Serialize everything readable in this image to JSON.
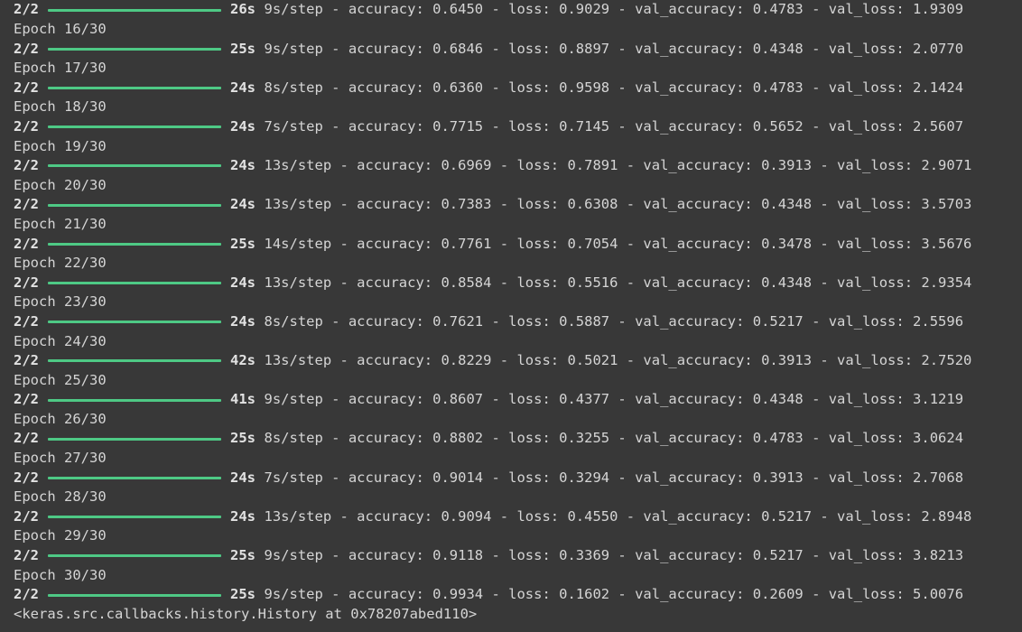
{
  "steps_prefix": "2/2",
  "bar_color": "#4ec985",
  "progress_fraction": 1.0,
  "lines": [
    {
      "kind": "progress",
      "time": "26s",
      "metrics": "9s/step - accuracy: 0.6450 - loss: 0.9029 - val_accuracy: 0.4783 - val_loss: 1.9309"
    },
    {
      "kind": "epoch",
      "text": "Epoch 16/30"
    },
    {
      "kind": "progress",
      "time": "25s",
      "metrics": "9s/step - accuracy: 0.6846 - loss: 0.8897 - val_accuracy: 0.4348 - val_loss: 2.0770"
    },
    {
      "kind": "epoch",
      "text": "Epoch 17/30"
    },
    {
      "kind": "progress",
      "time": "24s",
      "metrics": "8s/step - accuracy: 0.6360 - loss: 0.9598 - val_accuracy: 0.4783 - val_loss: 2.1424"
    },
    {
      "kind": "epoch",
      "text": "Epoch 18/30"
    },
    {
      "kind": "progress",
      "time": "24s",
      "metrics": "7s/step - accuracy: 0.7715 - loss: 0.7145 - val_accuracy: 0.5652 - val_loss: 2.5607"
    },
    {
      "kind": "epoch",
      "text": "Epoch 19/30"
    },
    {
      "kind": "progress",
      "time": "24s",
      "metrics": "13s/step - accuracy: 0.6969 - loss: 0.7891 - val_accuracy: 0.3913 - val_loss: 2.9071"
    },
    {
      "kind": "epoch",
      "text": "Epoch 20/30"
    },
    {
      "kind": "progress",
      "time": "24s",
      "metrics": "13s/step - accuracy: 0.7383 - loss: 0.6308 - val_accuracy: 0.4348 - val_loss: 3.5703"
    },
    {
      "kind": "epoch",
      "text": "Epoch 21/30"
    },
    {
      "kind": "progress",
      "time": "25s",
      "metrics": "14s/step - accuracy: 0.7761 - loss: 0.7054 - val_accuracy: 0.3478 - val_loss: 3.5676"
    },
    {
      "kind": "epoch",
      "text": "Epoch 22/30"
    },
    {
      "kind": "progress",
      "time": "24s",
      "metrics": "13s/step - accuracy: 0.8584 - loss: 0.5516 - val_accuracy: 0.4348 - val_loss: 2.9354"
    },
    {
      "kind": "epoch",
      "text": "Epoch 23/30"
    },
    {
      "kind": "progress",
      "time": "24s",
      "metrics": "8s/step - accuracy: 0.7621 - loss: 0.5887 - val_accuracy: 0.5217 - val_loss: 2.5596"
    },
    {
      "kind": "epoch",
      "text": "Epoch 24/30"
    },
    {
      "kind": "progress",
      "time": "42s",
      "metrics": "13s/step - accuracy: 0.8229 - loss: 0.5021 - val_accuracy: 0.3913 - val_loss: 2.7520"
    },
    {
      "kind": "epoch",
      "text": "Epoch 25/30"
    },
    {
      "kind": "progress",
      "time": "41s",
      "metrics": "9s/step - accuracy: 0.8607 - loss: 0.4377 - val_accuracy: 0.4348 - val_loss: 3.1219"
    },
    {
      "kind": "epoch",
      "text": "Epoch 26/30"
    },
    {
      "kind": "progress",
      "time": "25s",
      "metrics": "8s/step - accuracy: 0.8802 - loss: 0.3255 - val_accuracy: 0.4783 - val_loss: 3.0624"
    },
    {
      "kind": "epoch",
      "text": "Epoch 27/30"
    },
    {
      "kind": "progress",
      "time": "24s",
      "metrics": "7s/step - accuracy: 0.9014 - loss: 0.3294 - val_accuracy: 0.3913 - val_loss: 2.7068"
    },
    {
      "kind": "epoch",
      "text": "Epoch 28/30"
    },
    {
      "kind": "progress",
      "time": "24s",
      "metrics": "13s/step - accuracy: 0.9094 - loss: 0.4550 - val_accuracy: 0.5217 - val_loss: 2.8948"
    },
    {
      "kind": "epoch",
      "text": "Epoch 29/30"
    },
    {
      "kind": "progress",
      "time": "25s",
      "metrics": "9s/step - accuracy: 0.9118 - loss: 0.3369 - val_accuracy: 0.5217 - val_loss: 3.8213"
    },
    {
      "kind": "epoch",
      "text": "Epoch 30/30"
    },
    {
      "kind": "progress",
      "time": "25s",
      "metrics": "9s/step - accuracy: 0.9934 - loss: 0.1602 - val_accuracy: 0.2609 - val_loss: 5.0076"
    },
    {
      "kind": "result",
      "text": "<keras.src.callbacks.history.History at 0x78207abed110>"
    }
  ]
}
